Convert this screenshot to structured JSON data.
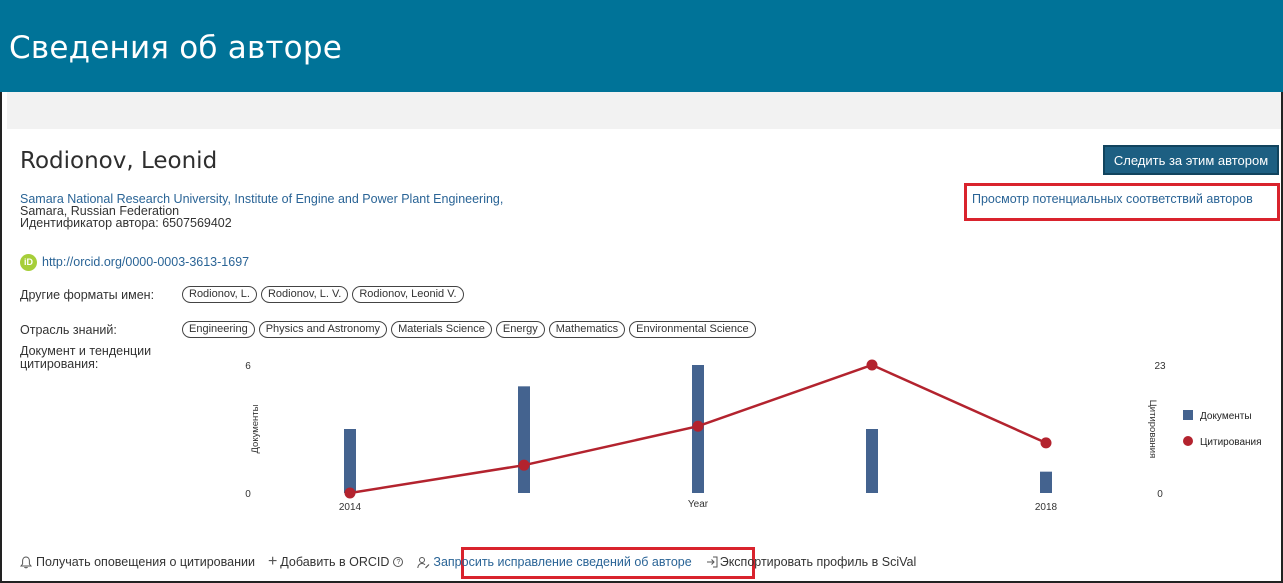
{
  "header": {
    "title": "Сведения об авторе"
  },
  "author": {
    "name": "Rodionov, Leonid",
    "follow_label": "Следить за этим автором",
    "affiliation": "Samara National Research University, Institute of Engine and Power Plant Engineering,",
    "location": "Samara, Russian Federation",
    "author_id": "Идентификатор автора: 6507569402",
    "potential_matches": "Просмотр потенциальных соответствий авторов",
    "orcid_url": "http://orcid.org/0000-0003-3613-1697",
    "orcid_badge": "iD"
  },
  "name_formats": {
    "label": "Другие форматы имен:",
    "items": [
      "Rodionov, L.",
      "Rodionov, L. V.",
      "Rodionov, Leonid V."
    ]
  },
  "subject_areas": {
    "label": "Отрасль знаний:",
    "items": [
      "Engineering",
      "Physics and Astronomy",
      "Materials Science",
      "Energy",
      "Mathematics",
      "Environmental Science"
    ]
  },
  "trends": {
    "label_line1": "Документ и тенденции",
    "label_line2": "цитирования:"
  },
  "chart_data": {
    "type": "bar",
    "xlabel": "Year",
    "ylabel_left": "Документы",
    "ylabel_right": "Цитирования",
    "tick_labels": [
      "2014",
      "2018"
    ],
    "x": [
      2014,
      2015,
      2016,
      2017,
      2018
    ],
    "left_ylim": [
      0,
      6
    ],
    "right_ylim": [
      0,
      23
    ],
    "series": [
      {
        "name": "Документы",
        "type": "bar",
        "color": "#44638f",
        "values": [
          3,
          5,
          6,
          3,
          1
        ]
      },
      {
        "name": "Цитирования",
        "type": "line",
        "color": "#b3232e",
        "values": [
          0,
          5,
          12,
          23,
          9
        ]
      }
    ],
    "legend_position": "right"
  },
  "actions": {
    "alerts": "Получать оповещения о цитировании",
    "orcid_add": "Добавить в ORCID",
    "correction": "Запросить исправление сведений об авторе",
    "scival": "Экспортировать профиль в SciVal"
  }
}
